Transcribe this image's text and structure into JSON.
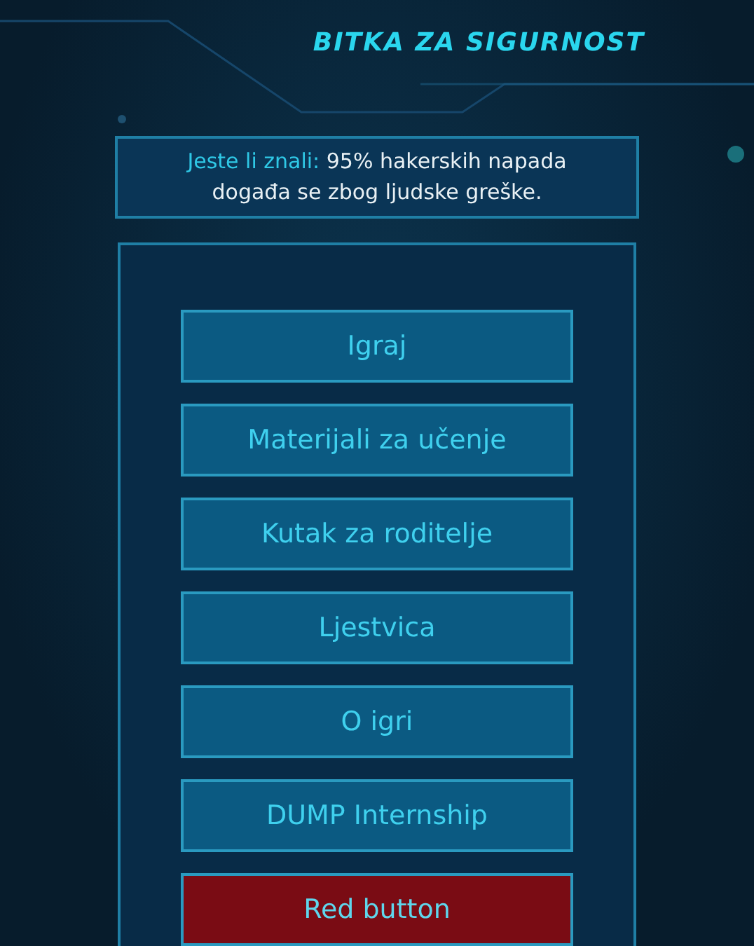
{
  "logo": {
    "subtitle": "BITKA ZA SIGURNOST"
  },
  "fact": {
    "text": "**Jeste li znali:** 95% hakerskih napada događa se zbog ljudske greške."
  },
  "menu": [
    {
      "label": "Igraj",
      "kind": "normal"
    },
    {
      "label": "Materijali za učenje",
      "kind": "normal"
    },
    {
      "label": "Kutak za roditelje",
      "kind": "normal"
    },
    {
      "label": "Ljestvica",
      "kind": "normal"
    },
    {
      "label": "O igri",
      "kind": "normal"
    },
    {
      "label": "DUMP Internship",
      "kind": "normal"
    },
    {
      "label": "Red button",
      "kind": "danger"
    }
  ]
}
